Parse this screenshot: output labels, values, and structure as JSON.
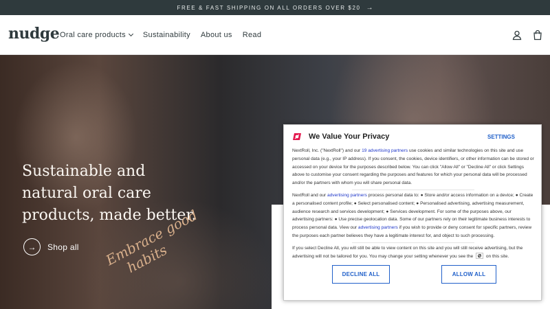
{
  "announcement": {
    "text": "FREE & FAST SHIPPING ON ALL ORDERS OVER $20",
    "arrow": "→"
  },
  "header": {
    "logo": "nudge",
    "nav": [
      {
        "label": "Oral care products",
        "has_dropdown": true
      },
      {
        "label": "Sustainability"
      },
      {
        "label": "About us"
      },
      {
        "label": "Read"
      }
    ],
    "icons": [
      "user-icon",
      "bag-icon"
    ]
  },
  "hero": {
    "title": "Sustainable and natural oral care products, made better.",
    "script_line1": "Embrace good",
    "script_line2": "habits",
    "cta_label": "Shop all",
    "cta_icon": "arrow-right-icon"
  },
  "consent": {
    "title": "We Value Your Privacy",
    "settings_label": "SETTINGS",
    "p1": {
      "a": "NextRoll, Inc. (\"NextRoll\") and our ",
      "link": "19 advertising partners",
      "b": " use cookies and similar technologies on this site and use personal data (e.g., your IP address). If you consent, the cookies, device identifiers, or other information can be stored or accessed on your device for the purposes described below. You can click \"Allow All\" or \"Decline All\" or click Settings above to customise your consent regarding the purposes and features for which your personal data will be processed and/or the partners with whom you will share personal data."
    },
    "p2": {
      "a": "NextRoll and our ",
      "link1": "advertising partners",
      "b": " process personal data to: ● Store and/or access information on a device; ● Create a personalised content profile; ● Select personalised content; ● Personalised advertising, advertising measurement, audience research and services development; ● Services development. For some of the purposes above, our advertising partners: ● Use precise geolocation data. Some of our partners rely on their legitimate business interests to process personal data. View our ",
      "link2": "advertising partners",
      "c": " if you wish to provide or deny consent for specific partners, review the purposes each partner believes they have a legitimate interest for, and object to such processing."
    },
    "p3": {
      "a": "If you select Decline All, you will still be able to view content on this site and you will still receive advertising, but the advertising will not be tailored for you. You may change your setting whenever you see the ",
      "b": " on this site."
    },
    "decline_label": "DECLINE ALL",
    "allow_label": "ALLOW ALL"
  },
  "colors": {
    "announce_bg": "#2f3a3d",
    "brand_text": "#2f3a3d",
    "consent_blue": "#1f5fc9",
    "consent_logo_red": "#e3154b",
    "script_gold": "#d9b08c"
  }
}
